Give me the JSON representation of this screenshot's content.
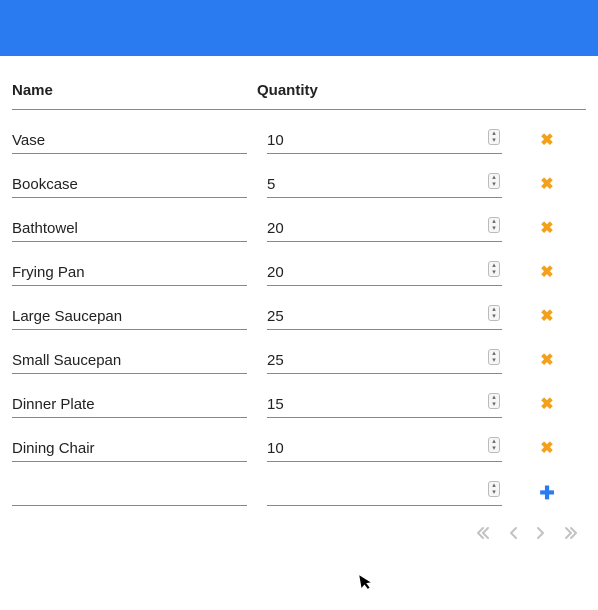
{
  "headers": {
    "name": "Name",
    "quantity": "Quantity"
  },
  "items": [
    {
      "name": "Vase",
      "quantity": "10"
    },
    {
      "name": "Bookcase",
      "quantity": "5"
    },
    {
      "name": "Bathtowel",
      "quantity": "20"
    },
    {
      "name": "Frying Pan",
      "quantity": "20"
    },
    {
      "name": "Large Saucepan",
      "quantity": "25"
    },
    {
      "name": "Small Saucepan",
      "quantity": "25"
    },
    {
      "name": "Dinner Plate",
      "quantity": "15"
    },
    {
      "name": "Dining Chair",
      "quantity": "10"
    }
  ],
  "new_row": {
    "name": "",
    "quantity": ""
  },
  "colors": {
    "primary": "#2a7af0",
    "accent": "#f3a01a"
  }
}
